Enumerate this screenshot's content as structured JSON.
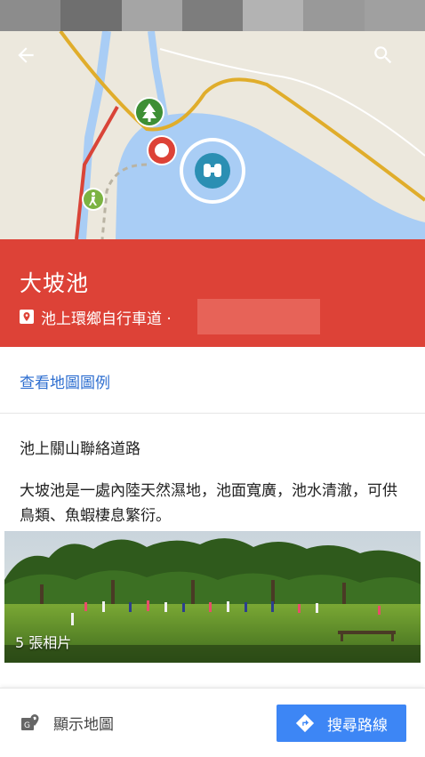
{
  "statusbar": {
    "tones": [
      "#9a9a9a",
      "#7f7f7f",
      "#a8a8a8",
      "#8d8d8d",
      "#b0b0b0",
      "#999999",
      "#a3a3a3"
    ]
  },
  "colors": {
    "header": "#dd4237",
    "link": "#2f6fd0",
    "route_button": "#3d86f5"
  },
  "map": {
    "icons": [
      "back-arrow-icon",
      "search-icon",
      "tree-marker-icon",
      "selected-place-marker-icon",
      "binoculars-marker-icon",
      "hiking-marker-icon"
    ]
  },
  "place": {
    "title": "大坡池",
    "address": "池上環鄉自行車道 ·"
  },
  "legend_link": "查看地圖圖例",
  "section_title": "池上關山聯絡道路",
  "description": "大坡池是一處內陸天然濕地，池面寬廣，池水清澈，可供鳥類、魚蝦棲息繁衍。",
  "photo": {
    "count_label": "5 張相片"
  },
  "bottom": {
    "show_map_label": "顯示地圖",
    "route_label": "搜尋路線"
  }
}
